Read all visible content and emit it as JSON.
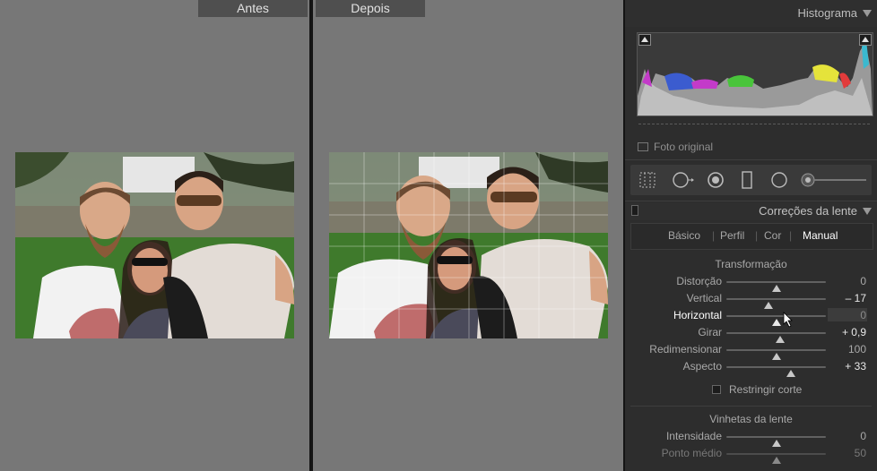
{
  "compare": {
    "before_label": "Antes",
    "after_label": "Depois"
  },
  "histogram": {
    "title": "Histograma",
    "show_original_label": "Foto original"
  },
  "lens_panel": {
    "title": "Correções da lente",
    "tabs": [
      {
        "label": "Básico",
        "active": false
      },
      {
        "label": "Perfil",
        "active": false
      },
      {
        "label": "Cor",
        "active": false
      },
      {
        "label": "Manual",
        "active": true
      }
    ],
    "transform_title": "Transformação",
    "sliders": [
      {
        "label": "Distorção",
        "value": "0",
        "position": 0.5
      },
      {
        "label": "Vertical",
        "value": "– 17",
        "position": 0.42
      },
      {
        "label": "Horizontal",
        "value": "0",
        "position": 0.5,
        "active": true
      },
      {
        "label": "Girar",
        "value": "+ 0,9",
        "position": 0.54
      },
      {
        "label": "Redimensionar",
        "value": "100",
        "position": 0.5
      },
      {
        "label": "Aspecto",
        "value": "+ 33",
        "position": 0.65
      }
    ],
    "constrain_label": "Restringir corte",
    "vignette_title": "Vinhetas da lente",
    "vignette_sliders": [
      {
        "label": "Intensidade",
        "value": "0",
        "position": 0.5
      },
      {
        "label": "Ponto médio",
        "value": "50",
        "position": 0.5
      }
    ]
  },
  "colors": {
    "panel_bg": "#2d2d2d",
    "canvas_bg": "#777777",
    "active_text": "#ffffff"
  }
}
